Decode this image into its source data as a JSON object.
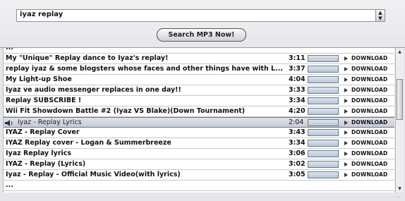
{
  "search": {
    "selected_value": "iyaz replay",
    "button_label": "Search MP3 Now!"
  },
  "results": [
    {
      "title": "...",
      "duration": "",
      "download_label": ""
    },
    {
      "title": "My \"Unique\" Replay dance to Iyaz's replay!",
      "duration": "3:11",
      "download_label": "DOWNLOAD"
    },
    {
      "title": "replay iyaz & some blogsters whose faces and other things have with L...",
      "duration": "3:37",
      "download_label": "DOWNLOAD"
    },
    {
      "title": "My Light-up Shoe",
      "duration": "4:04",
      "download_label": "DOWNLOAD"
    },
    {
      "title": "Iyaz ve audio messenger replaces in one day!!",
      "duration": "3:33",
      "download_label": "DOWNLOAD"
    },
    {
      "title": "Replay SUBSCRIBE !",
      "duration": "3:34",
      "download_label": "DOWNLOAD"
    },
    {
      "title": "Wii Fit Showdown Battle #2 (Iyaz VS Blake)(Down Tournament)",
      "duration": "4:20",
      "download_label": "DOWNLOAD"
    },
    {
      "title": "Iyaz - Replay Lyrics",
      "duration": "2:04",
      "download_label": "DOWNLOAD"
    },
    {
      "title": "IYAZ - Replay Cover",
      "duration": "3:43",
      "download_label": "DOWNLOAD"
    },
    {
      "title": "IYAZ Replay cover - Logan & Summerbreeze",
      "duration": "3:34",
      "download_label": "DOWNLOAD"
    },
    {
      "title": "Iyaz Replay lyrics",
      "duration": "3:06",
      "download_label": "DOWNLOAD"
    },
    {
      "title": "IYAZ - Replay (Lyrics)",
      "duration": "3:02",
      "download_label": "DOWNLOAD"
    },
    {
      "title": "Iyaz - Replay - Official Music Video(with lyrics)",
      "duration": "3:05",
      "download_label": "DOWNLOAD"
    },
    {
      "title": "...",
      "duration": "",
      "download_label": ""
    }
  ],
  "footer": {
    "text": "..."
  },
  "colors": {
    "highlight": "#c7cbd6",
    "bar": "#b9c6d6"
  }
}
